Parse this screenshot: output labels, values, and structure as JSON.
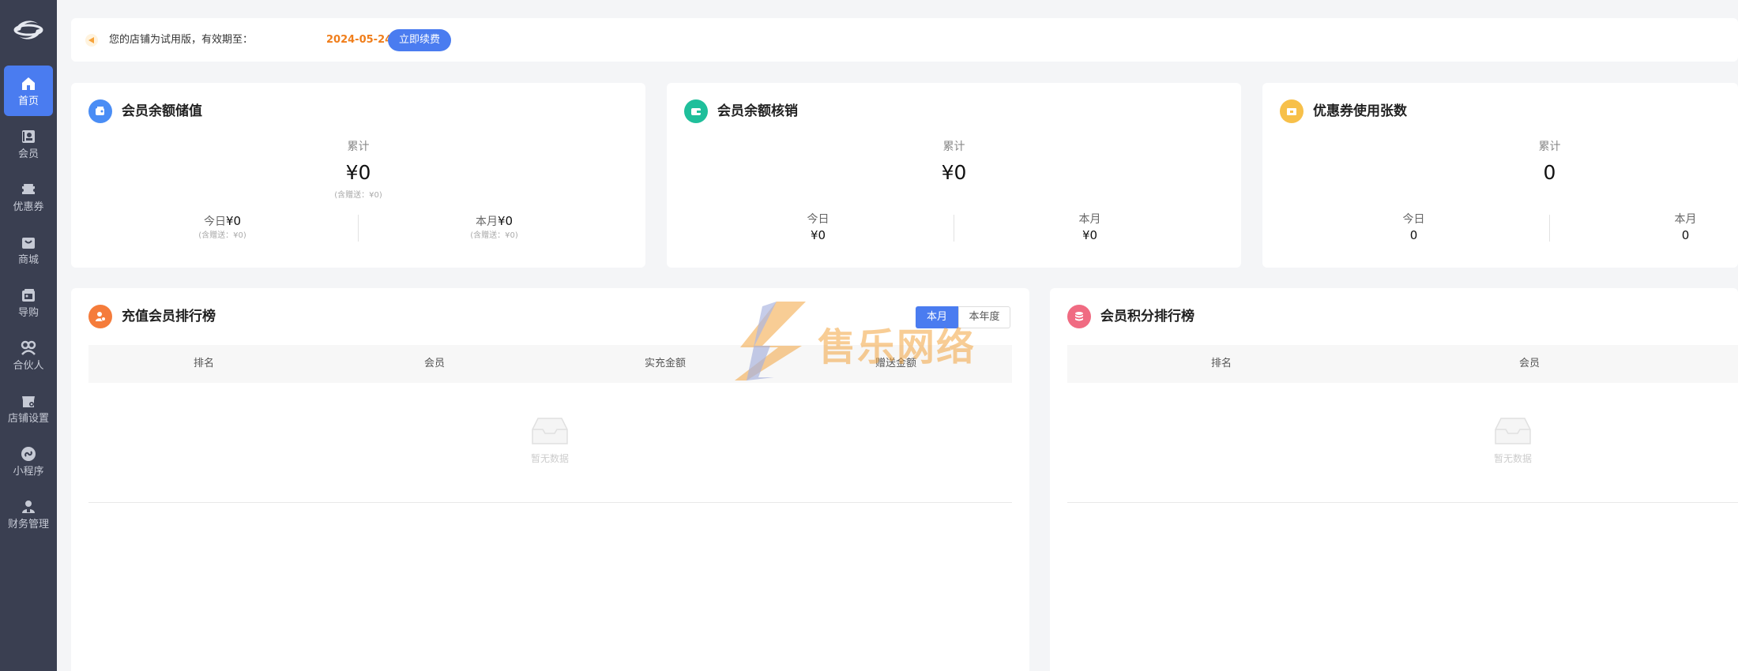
{
  "sidebar": {
    "items": [
      {
        "label": "首页",
        "icon": "home-icon",
        "active": true
      },
      {
        "label": "会员",
        "icon": "member-card-icon"
      },
      {
        "label": "优惠券",
        "icon": "coupon-icon"
      },
      {
        "label": "商城",
        "icon": "bag-icon"
      },
      {
        "label": "导购",
        "icon": "guide-icon"
      },
      {
        "label": "合伙人",
        "icon": "partner-icon"
      },
      {
        "label": "店铺设置",
        "icon": "store-icon"
      },
      {
        "label": "小程序",
        "icon": "miniapp-icon"
      },
      {
        "label": "财务管理",
        "icon": "finance-icon"
      }
    ]
  },
  "notice": {
    "text": "您的店铺为试用版，有效期至：",
    "date": "2024-05-24",
    "button": "立即续费"
  },
  "stats": [
    {
      "title": "会员余额储值",
      "icon_color": "#4a8df5",
      "total_label": "累计",
      "total_value": "¥0",
      "total_sub": "(含赠送：¥0)",
      "today_label": "今日",
      "today_value": "¥0",
      "today_sub": "(含赠送：¥0)",
      "month_label": "本月",
      "month_value": "¥0",
      "month_sub": "(含赠送：¥0)"
    },
    {
      "title": "会员余额核销",
      "icon_color": "#1fbf9b",
      "total_label": "累计",
      "total_value": "¥0",
      "today_label": "今日",
      "today_value": "¥0",
      "month_label": "本月",
      "month_value": "¥0"
    },
    {
      "title": "优惠券使用张数",
      "icon_color": "#f7c04a",
      "total_label": "累计",
      "total_value": "0",
      "today_label": "今日",
      "today_value": "0",
      "month_label": "本月",
      "month_value": "0"
    }
  ],
  "recharge_rank": {
    "title": "充值会员排行榜",
    "icon_color": "#f57c3b",
    "tabs": [
      "本月",
      "本年度"
    ],
    "columns": [
      "排名",
      "会员",
      "实充金额",
      "赠送金额"
    ],
    "empty": "暂无数据"
  },
  "points_rank": {
    "title": "会员积分排行榜",
    "icon_color": "#f06b82",
    "columns": [
      "排名",
      "会员"
    ],
    "empty": "暂无数据"
  },
  "watermark": {
    "text": "售乐网络"
  }
}
